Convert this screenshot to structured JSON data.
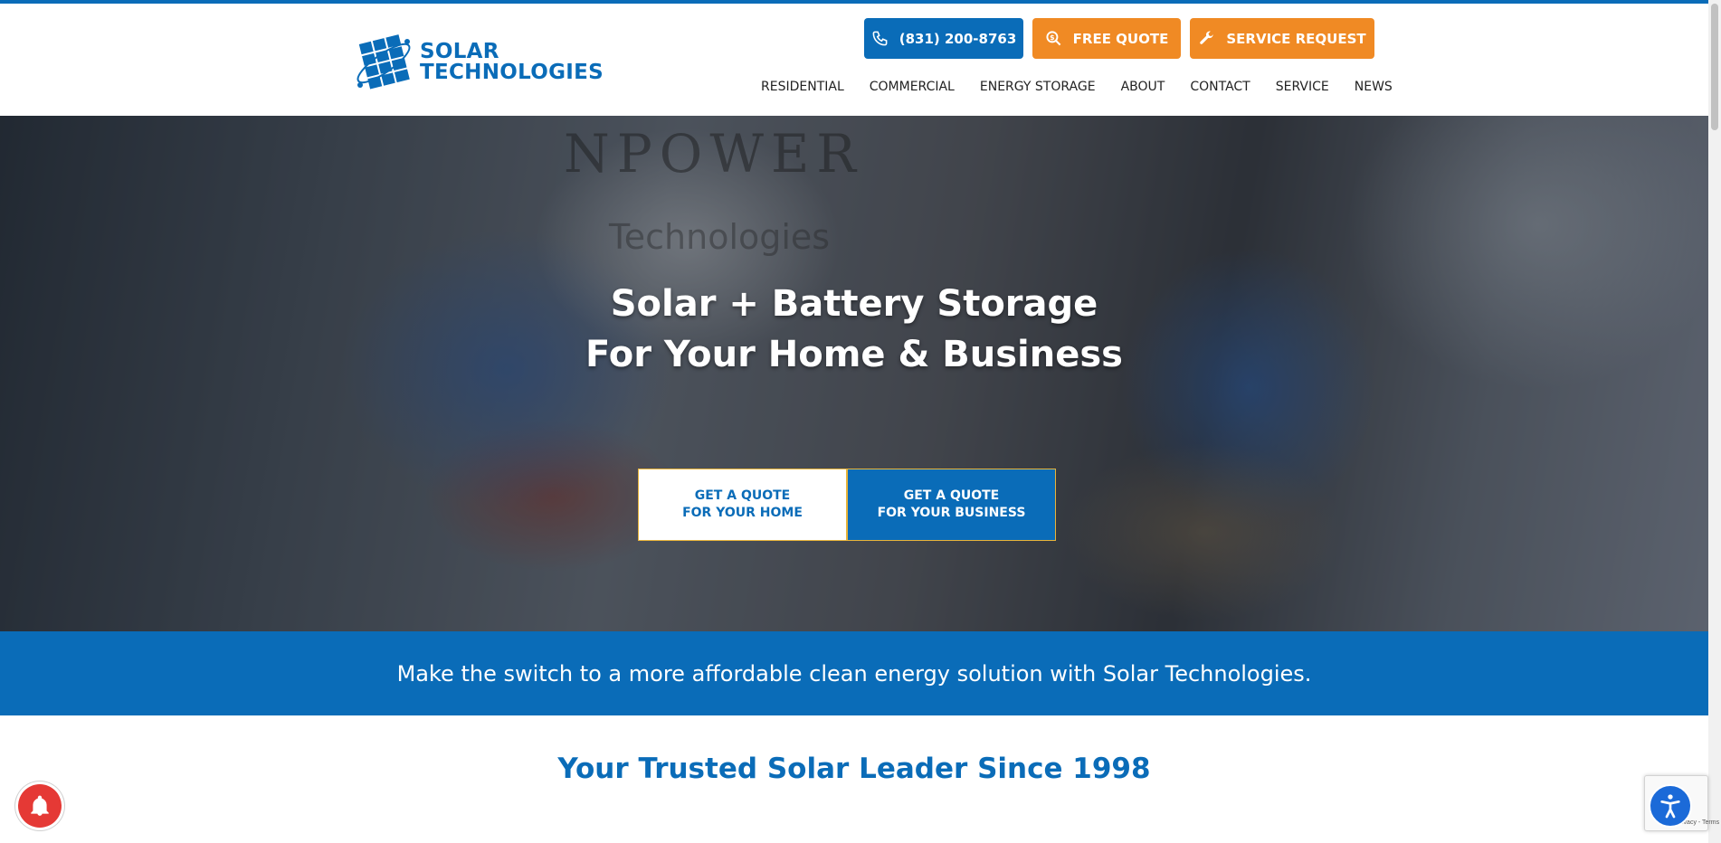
{
  "header": {
    "logo": {
      "line1": "SOLAR",
      "line2": "TECHNOLOGIES"
    },
    "buttons": {
      "phone": "(831) 200-8763",
      "quote": "FREE QUOTE",
      "service": "SERVICE REQUEST"
    },
    "nav": [
      {
        "label": "RESIDENTIAL"
      },
      {
        "label": "COMMERCIAL"
      },
      {
        "label": "ENERGY STORAGE"
      },
      {
        "label": "ABOUT"
      },
      {
        "label": "CONTACT"
      },
      {
        "label": "SERVICE"
      },
      {
        "label": "NEWS"
      }
    ]
  },
  "hero": {
    "van_text_1": "NPOWER",
    "van_text_2": "Technologies",
    "title_line1": "Solar + Battery Storage",
    "title_line2": "For Your Home & Business",
    "cta_home_line1": "GET A QUOTE",
    "cta_home_line2": "FOR YOUR HOME",
    "cta_business_line1": "GET A QUOTE",
    "cta_business_line2": "FOR YOUR BUSINESS"
  },
  "band": {
    "text": "Make the switch to a more affordable clean energy solution with Solar Technologies."
  },
  "section": {
    "title": "Your Trusted Solar Leader Since 1998"
  },
  "widgets": {
    "recaptcha_terms": "Privacy - Terms"
  },
  "colors": {
    "brand_blue": "#0a6cb8",
    "brand_orange": "#f08a24",
    "notification_red": "#e53935"
  },
  "icons": {
    "phone": "phone-icon",
    "quote": "search-dollar-icon",
    "service": "wrench-icon",
    "notification": "bell-icon",
    "accessibility": "accessibility-icon"
  }
}
